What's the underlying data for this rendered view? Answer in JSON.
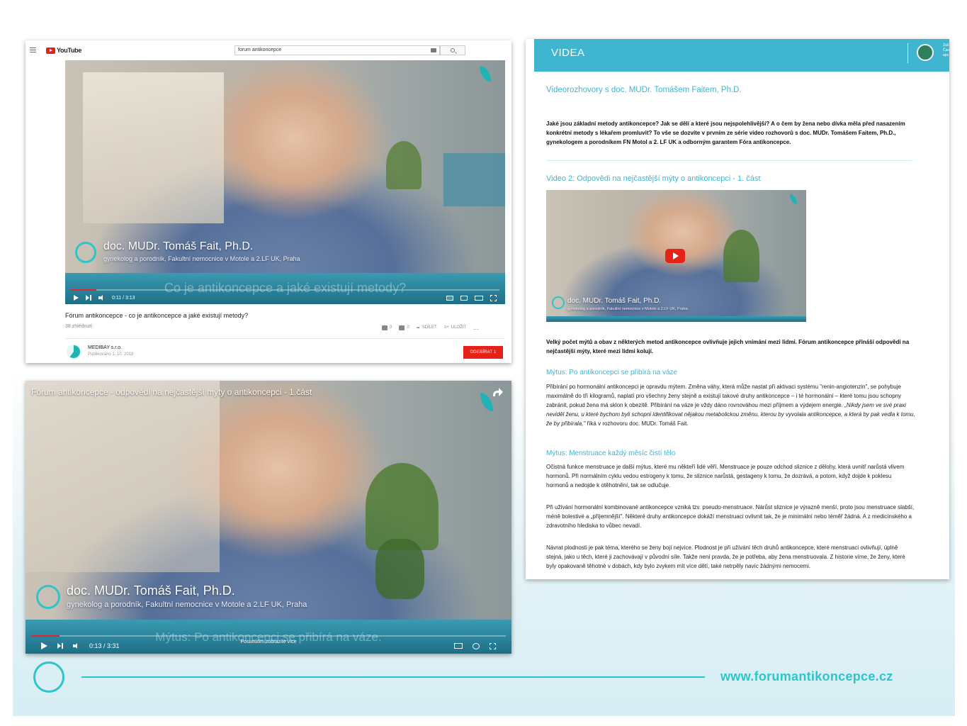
{
  "youtube": {
    "logo": "YouTube",
    "search_value": "forum antikoncepce",
    "video": {
      "caption_name": "doc. MUDr. Tomáš Fait, Ph.D.",
      "caption_role": "gynekolog a porodník, Fakultní nemocnice v Motole a 2.LF UK, Praha",
      "subtitle": "Co je antikoncepce a jaké existují metody?",
      "time": "0:11 / 3:13",
      "progress": 0.06
    },
    "title": "Fórum antikoncepce - co je antikoncepce a jaké existují metody?",
    "views": "38 zhlédnutí",
    "likes": "0",
    "dislikes": "0",
    "share": "SDÍLET",
    "save": "ULOŽIT",
    "more": "...",
    "channel": "MEDIBAY s.r.o.",
    "published": "Publikováno 1. 10. 2018",
    "subscribe": "ODEBÍRAT 1"
  },
  "big_video": {
    "title": "Fórum antikoncepce - odpovědi na nejčastější mýty o antikoncepci - 1.část",
    "caption_name": "doc. MUDr. Tomáš Fait, Ph.D.",
    "caption_role": "gynekolog a porodník, Fakultní nemocnice v Motole a 2.LF UK, Praha",
    "subtitle": "Mýtus: Po antikoncepci se přibírá na váze.",
    "scroll_hint": "Posunutím zobrazíte více",
    "time": "0:13 / 3:31",
    "progress": 0.06
  },
  "article": {
    "header": "VIDEA",
    "seal_text": "Zaš Čas apo",
    "section_title": "Videorozhovory s doc. MUDr. Tomášem Faitem, Ph.D.",
    "intro": "Jaké jsou základní metody antikoncepce? Jak se dělí a které jsou nejspolehlivější? A o čem by žena nebo dívka měla před nasazením konkrétní metody s lékařem promluvit? To vše se dozvíte v prvním ze série video rozhovorů s doc. MUDr. Tomášem Faitem, Ph.D., gynekologem a porodníkem FN Motol a 2. LF UK a odborným garantem Fóra antikoncepce.",
    "video2_title": "Video 2: Odpovědi na nejčastější mýty o antikoncepci - 1. část",
    "thumb_name": "doc. MUDr. Tomáš Fait, Ph.D.",
    "thumb_role": "gynekolog a porodník, Fakultní nemocnice v Motole a 2.LF UK, Praha",
    "lead": "Velký počet mýtů a obav z některých metod antikoncepce ovlivňuje jejich vnímání mezi lidmi. Fórum antikoncepce přináší odpovědi na nejčastější mýty, které mezi lidmi kolují.",
    "myth1_title": "Mýtus: Po antikoncepci se přibírá na váze",
    "myth1_text": "Přibírání po hormonální antikoncepci je opravdu mýtem. Změna váhy, která může nastat při aktivaci systému \"renin-angiotenzin\", se pohybuje maximálně do tří kilogramů, naplatí pro všechny ženy stejně a existují takové druhy antikoncepce – i té hormonální – které tomu jsou schopny zabránit, pokud žena má sklon k obezitě. Přibírání na váze je vždy dáno rovnováhou mezi příjmem a výdejem energie.",
    "myth1_quote": "„Nikdy jsem ve své praxi neviděl ženu, u které bychom byli schopni identifikovat nějakou metabolickou změnu, kterou by vyvolala antikoncepce, a která by pak vedla k tomu, že by přibírala,\"",
    "myth1_tail": " říká v rozhovoru doc. MUDr. Tomáš Fait.",
    "myth2_title": "Mýtus: Menstruace každý měsíc čistí tělo",
    "myth2_p1": "Očistná funkce menstruace je další mýtus, které mu někteří lidé věří. Menstruace je pouze odchod sliznice z dělohy, která uvnitř narůstá vlivem hormonů. Při normálním cyklu vedou estrogeny k tomu, že sliznice narůstá, gestageny k tomu, že dozrává, a potom, když dojde k poklesu hormonů a nedojde k otěhotnění, tak se odlučuje.",
    "myth2_p2": "Při užívání hormonální kombinované antikoncepce vzniká tzv. pseudo-menstruace. Nárůst sliznice je výrazně menší, proto jsou menstruace slabší, méně bolestivé a „příjemnější\". Některé druhy antikoncepce dokáží menstruaci ovlivnit tak, že je minimální nebo téměř žádná. A z medicínského a zdravotního hlediska to vůbec nevadí.",
    "myth2_p3": "Návrat plodnosti je pak téma, kterého se ženy bojí nejvíce. Plodnost je při užívání těch druhů antikoncepce, které menstruaci ovlivňují, úplně stejná, jako u těch, které ji zachovávají v původní síle. Takže není pravda, že je potřeba, aby žena menstruovala. Z historie víme, že ženy, které byly opakovaně těhotné v dobách, kdy bylo zvykem mít více dětí, také netrpěly navíc žádnými nemocemi."
  },
  "footer": {
    "url": "www.forumantikoncepce.cz"
  },
  "colors": {
    "accent": "#2ec4c8",
    "header": "#3fb5d0",
    "youtube_red": "#e62117"
  }
}
